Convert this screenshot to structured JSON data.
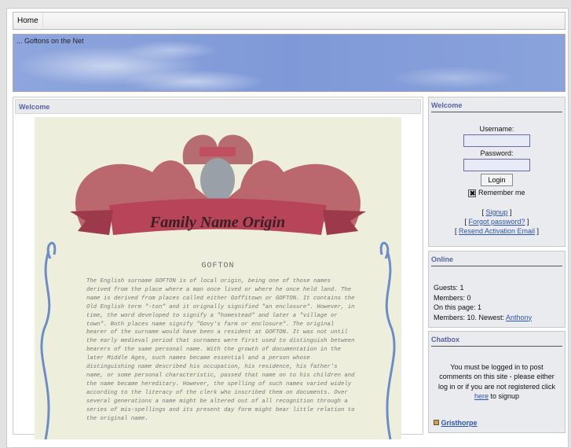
{
  "nav": {
    "items": [
      {
        "label": "Home"
      }
    ]
  },
  "banner": {
    "tagline": "... Goftons on the Net"
  },
  "main": {
    "title": "Welcome",
    "image": {
      "banner_text": "Family Name Origin",
      "heading": "GOFTON",
      "body": "The English surname GOFTON is of local origin, being one of those names derived from the place where a man once lived or where he once held land. The name is derived from places called either Goffitown or GOFTON. It contains the Old English term \"-ton\" and it orignally signified \"an enclosure\". However, in time, the word developed to signify a \"homestead\" and later a \"village or town\". Both places name signify \"Govy's farm or enclosure\". The original bearer of the surname would have been a resident at GOFTON. It was not until the early medieval period that surnames were first used to distinguish between bearers of the same personal name. With the growth of documentation in the later Middle Ages, such names became essential and a person whose distinguishing name described his occupation, his residence, his father's name, or some personal characteristic, passed that name on to his children and the name became hereditary. However, the spelling of such names varied widely according to the literacy of the clerk who inscribed them on documents. Over several generations a name might be altered out of all recognition through a series of mis-spellings and its present day form might bear little relation to the original name."
    }
  },
  "login": {
    "title": "Welcome",
    "username_label": "Username:",
    "username_value": "",
    "password_label": "Password:",
    "password_value": "",
    "login_button": "Login",
    "remember_label": "Remember me",
    "remember_checked": true,
    "signup": "Signup",
    "forgot": "Forgot password?",
    "resend": "Resend Activation Email",
    "lb": "[",
    "rb": "]"
  },
  "online": {
    "title": "Online",
    "guests": "Guests: 1",
    "members": "Members: 0",
    "on_page": "On this page: 1",
    "members_newest": "Members: 10. Newest:",
    "newest_user": "Anthony"
  },
  "chatbox": {
    "title": "Chatbox",
    "msg_before": "You must be logged in to post comments on this site - please either log in or if you are not registered click",
    "here": "here",
    "msg_after": "to signup",
    "user": "Gristhorpe"
  }
}
